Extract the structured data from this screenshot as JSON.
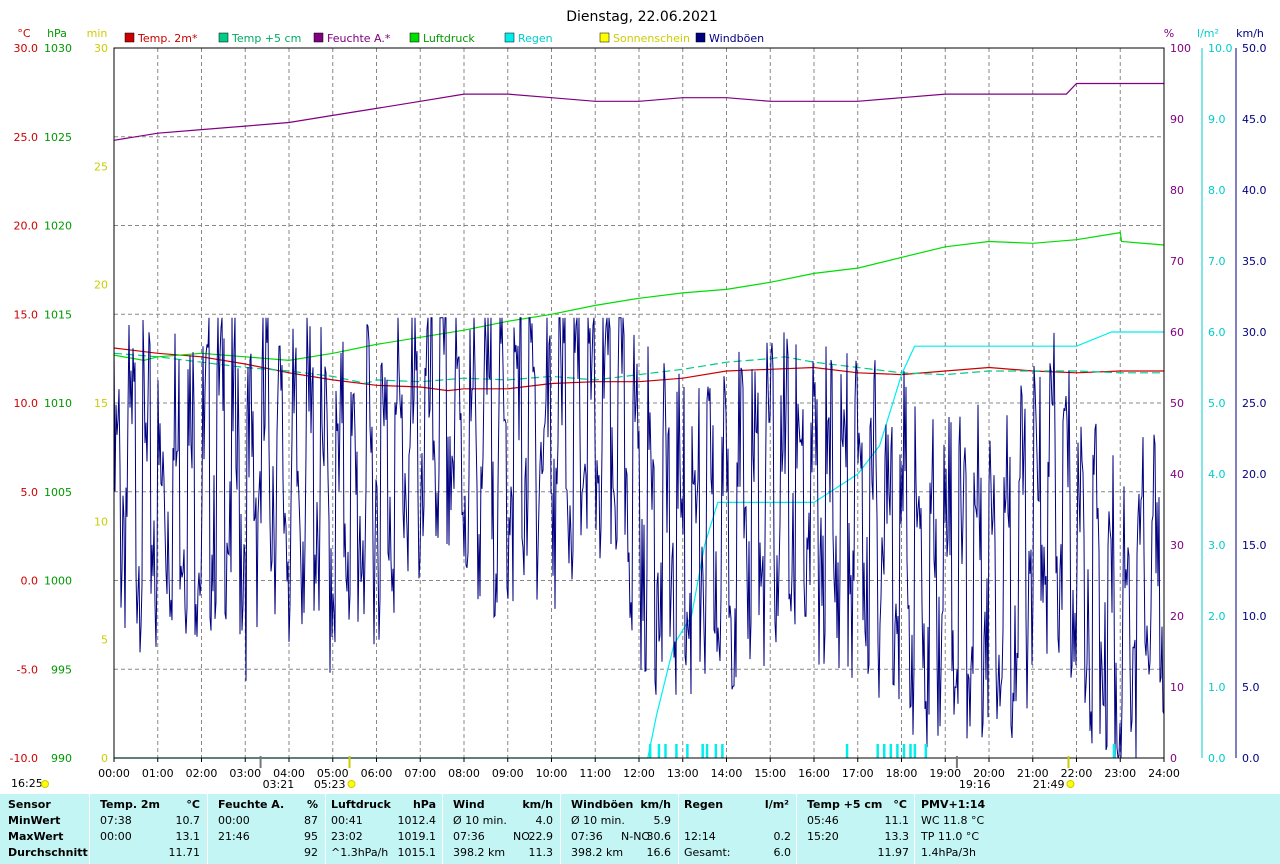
{
  "chart_data": {
    "type": "line",
    "title": "Dienstag, 22.06.2021",
    "x_ticks": [
      "00:00",
      "01:00",
      "02:00",
      "03:00",
      "04:00",
      "05:00",
      "06:00",
      "07:00",
      "08:00",
      "09:00",
      "10:00",
      "11:00",
      "12:00",
      "13:00",
      "14:00",
      "15:00",
      "16:00",
      "17:00",
      "18:00",
      "19:00",
      "20:00",
      "21:00",
      "22:00",
      "23:00",
      "24:00"
    ],
    "axes": {
      "temp": {
        "unit": "°C",
        "color": "#cc0000",
        "range": [
          -10,
          30
        ],
        "ticks": [
          "30.0",
          "25.0",
          "20.0",
          "15.0",
          "10.0",
          "5.0",
          "0.0",
          "-5.0",
          "-10.0"
        ]
      },
      "press": {
        "unit": "hPa",
        "color": "#009900",
        "range": [
          990,
          1030
        ],
        "ticks": [
          "1030",
          "1025",
          "1020",
          "1015",
          "1010",
          "1005",
          "1000",
          "995",
          "990"
        ]
      },
      "sun": {
        "unit": "min",
        "color": "#cccc00",
        "range": [
          0,
          30
        ],
        "ticks": [
          "30",
          "25",
          "20",
          "15",
          "10",
          "5",
          "0"
        ]
      },
      "hum": {
        "unit": "%",
        "color": "#800080",
        "range": [
          0,
          100
        ],
        "ticks": [
          "100",
          "90",
          "80",
          "70",
          "60",
          "50",
          "40",
          "30",
          "20",
          "10",
          "0"
        ]
      },
      "rain": {
        "unit": "l/m²",
        "color": "#00cccc",
        "range": [
          0,
          10
        ],
        "ticks": [
          "10.0",
          "9.0",
          "8.0",
          "7.0",
          "6.0",
          "5.0",
          "4.0",
          "3.0",
          "2.0",
          "1.0",
          "0.0"
        ]
      },
      "wind": {
        "unit": "km/h",
        "color": "#000080",
        "range": [
          0,
          50
        ],
        "ticks": [
          "50.0",
          "45.0",
          "40.0",
          "35.0",
          "30.0",
          "25.0",
          "20.0",
          "15.0",
          "10.0",
          "5.0",
          "0.0"
        ]
      }
    },
    "legend": [
      {
        "label": "Temp. 2m*",
        "color": "#cc0000",
        "text_color": "#cc0000"
      },
      {
        "label": "Temp +5 cm",
        "color": "#00cc88",
        "text_color": "#00aa66"
      },
      {
        "label": "Feuchte A.*",
        "color": "#800080",
        "text_color": "#800080"
      },
      {
        "label": "Luftdruck",
        "color": "#00dd00",
        "text_color": "#009900"
      },
      {
        "label": "Regen",
        "color": "#00eeee",
        "text_color": "#00cccc"
      },
      {
        "label": "Sonnenschein",
        "color": "#ffff00",
        "text_color": "#cccc00"
      },
      {
        "label": "Windböen",
        "color": "#000080",
        "text_color": "#000080"
      }
    ],
    "series": [
      {
        "name": "Temp. 2m*",
        "axis": "temp",
        "color": "#cc0000",
        "x": [
          0,
          1,
          2,
          3,
          4,
          5,
          6,
          7,
          7.63,
          8,
          9,
          10,
          11,
          12,
          13,
          14,
          15,
          16,
          17,
          18,
          19,
          20,
          21,
          22,
          23,
          24
        ],
        "y": [
          13.1,
          12.8,
          12.6,
          12.2,
          11.7,
          11.3,
          11.0,
          10.9,
          10.7,
          10.8,
          10.8,
          11.1,
          11.2,
          11.2,
          11.4,
          11.8,
          11.9,
          12.0,
          11.7,
          11.6,
          11.8,
          12.0,
          11.8,
          11.7,
          11.8,
          11.8
        ]
      },
      {
        "name": "Temp +5 cm",
        "axis": "temp",
        "color": "#00cc88",
        "style": "dashed",
        "x": [
          0,
          1,
          2,
          3,
          4,
          5,
          5.77,
          6,
          7,
          8,
          9,
          10,
          11,
          12,
          13,
          14,
          15,
          15.33,
          16,
          17,
          18,
          19,
          20,
          21,
          22,
          23,
          24
        ],
        "y": [
          12.8,
          12.6,
          12.3,
          12.0,
          11.8,
          11.5,
          11.1,
          11.3,
          11.2,
          11.4,
          11.3,
          11.5,
          11.3,
          11.6,
          11.9,
          12.3,
          12.5,
          12.6,
          12.3,
          12.0,
          11.7,
          11.6,
          11.8,
          11.8,
          11.8,
          11.7,
          11.7
        ]
      },
      {
        "name": "Feuchte A.*",
        "axis": "hum",
        "color": "#800080",
        "x": [
          0,
          1,
          2,
          3,
          4,
          5,
          6,
          7,
          8,
          9,
          10,
          11,
          12,
          13,
          14,
          15,
          16,
          17,
          18,
          19,
          20,
          21,
          21.77,
          22,
          23,
          24
        ],
        "y": [
          87,
          88,
          88.5,
          89,
          89.5,
          90.5,
          91.5,
          92.5,
          93.5,
          93.5,
          93,
          92.5,
          92.5,
          93,
          93,
          92.5,
          92.5,
          92.5,
          93,
          93.5,
          93.5,
          93.5,
          93.5,
          95,
          95,
          95
        ]
      },
      {
        "name": "Luftdruck",
        "axis": "press",
        "color": "#00dd00",
        "x": [
          0,
          0.68,
          1,
          2,
          3,
          4,
          5,
          6,
          7,
          8,
          9,
          10,
          11,
          12,
          13,
          14,
          15,
          16,
          17,
          18,
          19,
          20,
          21,
          22,
          23,
          23.03,
          24
        ],
        "y": [
          1012.7,
          1012.4,
          1012.6,
          1012.8,
          1012.6,
          1012.4,
          1012.8,
          1013.3,
          1013.7,
          1014.1,
          1014.6,
          1015.0,
          1015.5,
          1015.9,
          1016.2,
          1016.4,
          1016.8,
          1017.3,
          1017.6,
          1018.2,
          1018.8,
          1019.1,
          1019.0,
          1019.2,
          1019.6,
          1019.1,
          1018.9
        ]
      },
      {
        "name": "Regen",
        "axis": "rain",
        "color": "#00eeee",
        "x": [
          0,
          12.2,
          12.4,
          12.8,
          13.2,
          13.5,
          13.8,
          14.0,
          14.5,
          15.0,
          16.0,
          16.5,
          17.0,
          17.5,
          17.8,
          18.0,
          18.3,
          18.5,
          19.0,
          20.0,
          21.0,
          22.0,
          22.8,
          23.0,
          24.0
        ],
        "y": [
          0,
          0,
          0.6,
          1.6,
          2.0,
          3.0,
          3.6,
          3.6,
          3.6,
          3.6,
          3.6,
          3.8,
          4.0,
          4.4,
          5.0,
          5.4,
          5.8,
          5.8,
          5.8,
          5.8,
          5.8,
          5.8,
          6.0,
          6.0,
          6.0
        ]
      },
      {
        "name": "Windböen",
        "axis": "wind",
        "color": "#000080",
        "x": [
          0,
          0.5,
          1,
          1.5,
          2,
          2.5,
          3,
          3.5,
          4,
          4.5,
          5,
          5.3,
          5.5,
          6,
          6.5,
          7,
          7.5,
          8,
          8.5,
          9,
          9.5,
          10,
          10.5,
          11,
          11.5,
          12,
          12.5,
          13,
          13.5,
          14,
          14.5,
          15,
          15.5,
          16,
          16.5,
          17,
          17.5,
          18,
          18.5,
          19,
          19.5,
          20,
          20.5,
          21,
          21.5,
          22,
          22.5,
          23,
          23.5,
          24
        ],
        "y": [
          18,
          20,
          17,
          21,
          19,
          22,
          17,
          23,
          18,
          21,
          16,
          20,
          17,
          20,
          21,
          22,
          24,
          21,
          22,
          21,
          23,
          22,
          23,
          22,
          24,
          18,
          16,
          15,
          15,
          16,
          18,
          18,
          19,
          17,
          18,
          17,
          16,
          16,
          11,
          14,
          12,
          14,
          13,
          16,
          18,
          15,
          12,
          9,
          12,
          12
        ]
      }
    ],
    "rain_events_h": [
      12.25,
      12.45,
      12.6,
      12.85,
      13.1,
      13.45,
      13.55,
      13.75,
      13.9,
      16.75,
      17.45,
      17.6,
      17.75,
      17.9,
      18.05,
      18.2,
      18.3,
      18.55,
      22.85
    ],
    "markers": {
      "sunrise": "05:23",
      "sunset": "21:49",
      "extra_left": "03:21",
      "extra_right": "19:16",
      "corner_time": "16:25"
    }
  },
  "stats": [
    {
      "header": "Sensor",
      "unit": "",
      "rows": [
        [
          "MinWert",
          "",
          ""
        ],
        [
          "MaxWert",
          "",
          ""
        ],
        [
          "Durchschnitt",
          "",
          ""
        ]
      ]
    },
    {
      "header": "Temp. 2m",
      "unit": "°C",
      "rows": [
        [
          "07:38",
          "",
          "10.7"
        ],
        [
          "00:00",
          "",
          "13.1"
        ],
        [
          "",
          "",
          "11.71"
        ]
      ]
    },
    {
      "header": "Feuchte A.",
      "unit": "%",
      "rows": [
        [
          "00:00",
          "",
          "87"
        ],
        [
          "21:46",
          "",
          "95"
        ],
        [
          "",
          "",
          "92"
        ]
      ]
    },
    {
      "header": "Luftdruck",
      "unit": "hPa",
      "rows": [
        [
          "00:41",
          "",
          "1012.4"
        ],
        [
          "23:02",
          "",
          "1019.1"
        ],
        [
          "^1.3hPa/h",
          "",
          "1015.1"
        ]
      ]
    },
    {
      "header": "Wind",
      "unit": "km/h",
      "rows": [
        [
          "Ø 10 min.",
          "",
          "4.0"
        ],
        [
          "07:36",
          "NO",
          "22.9"
        ],
        [
          "398.2 km",
          "",
          "11.3"
        ]
      ]
    },
    {
      "header": "Windböen",
      "unit": "km/h",
      "rows": [
        [
          "Ø 10 min.",
          "",
          "5.9"
        ],
        [
          "07:36",
          "N-NO",
          "30.6"
        ],
        [
          "398.2 km",
          "",
          "16.6"
        ]
      ]
    },
    {
      "header": "Regen",
      "unit": "l/m²",
      "rows": [
        [
          "",
          "",
          ""
        ],
        [
          "12:14",
          "",
          "0.2"
        ],
        [
          "Gesamt:",
          "",
          "6.0"
        ]
      ]
    },
    {
      "header": "Temp +5 cm",
      "unit": "°C",
      "rows": [
        [
          "05:46",
          "",
          "11.1"
        ],
        [
          "15:20",
          "",
          "13.3"
        ],
        [
          "",
          "",
          "11.97"
        ]
      ]
    },
    {
      "header": "PMV+1:14",
      "unit": "",
      "rows": [
        [
          "WC 11.8 °C",
          "",
          ""
        ],
        [
          "TP 11.0 °C",
          "",
          ""
        ],
        [
          "1.4hPa/3h",
          "",
          ""
        ]
      ]
    }
  ]
}
